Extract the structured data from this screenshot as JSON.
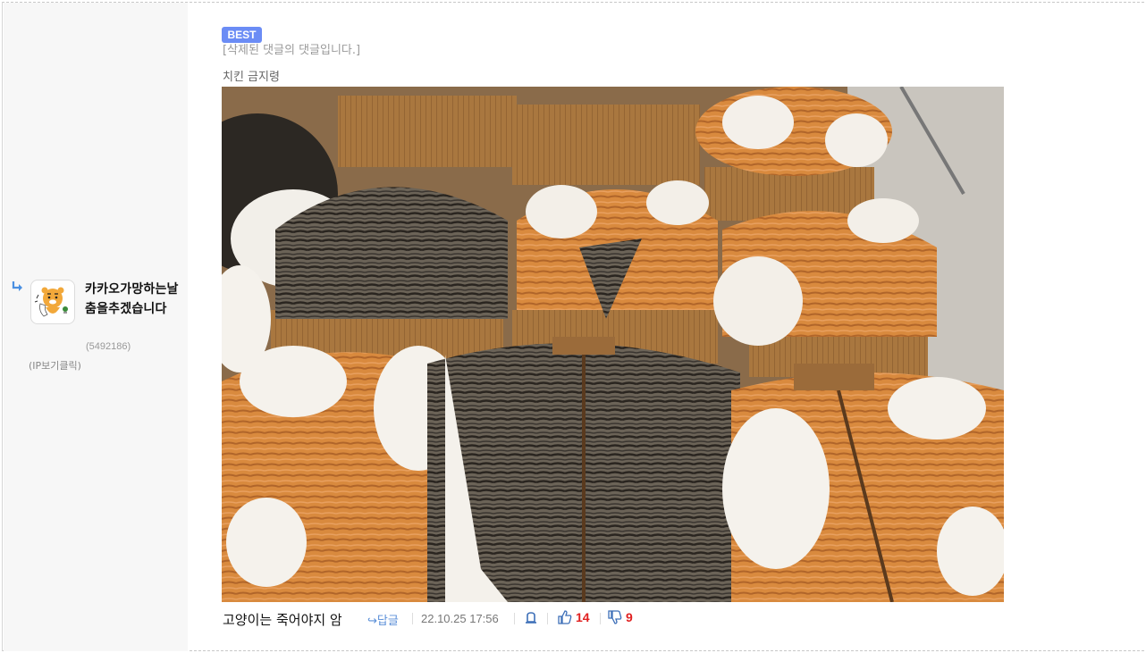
{
  "author": {
    "nickname": "카카오가망하는날 춤을추겠습니다",
    "user_id": "(5492186)",
    "ip_label": "(IP보기클릭)",
    "avatar_icon": "ryan-character-icon"
  },
  "comment": {
    "badge": "BEST",
    "deleted_parent": "[삭제된 댓글의 댓글입니다.]",
    "quote_line": "치킨 금지령",
    "image_icon": "cat-fur-vests-photo",
    "text": "고양이는 죽어야지 암",
    "reply_label": "답글",
    "datetime": "22.10.25 17:56",
    "upvotes": "14",
    "downvotes": "9"
  },
  "colors": {
    "best_badge": "#6b8cf5",
    "reply_link": "#5b8fd8",
    "vote_count": "#e02020"
  }
}
